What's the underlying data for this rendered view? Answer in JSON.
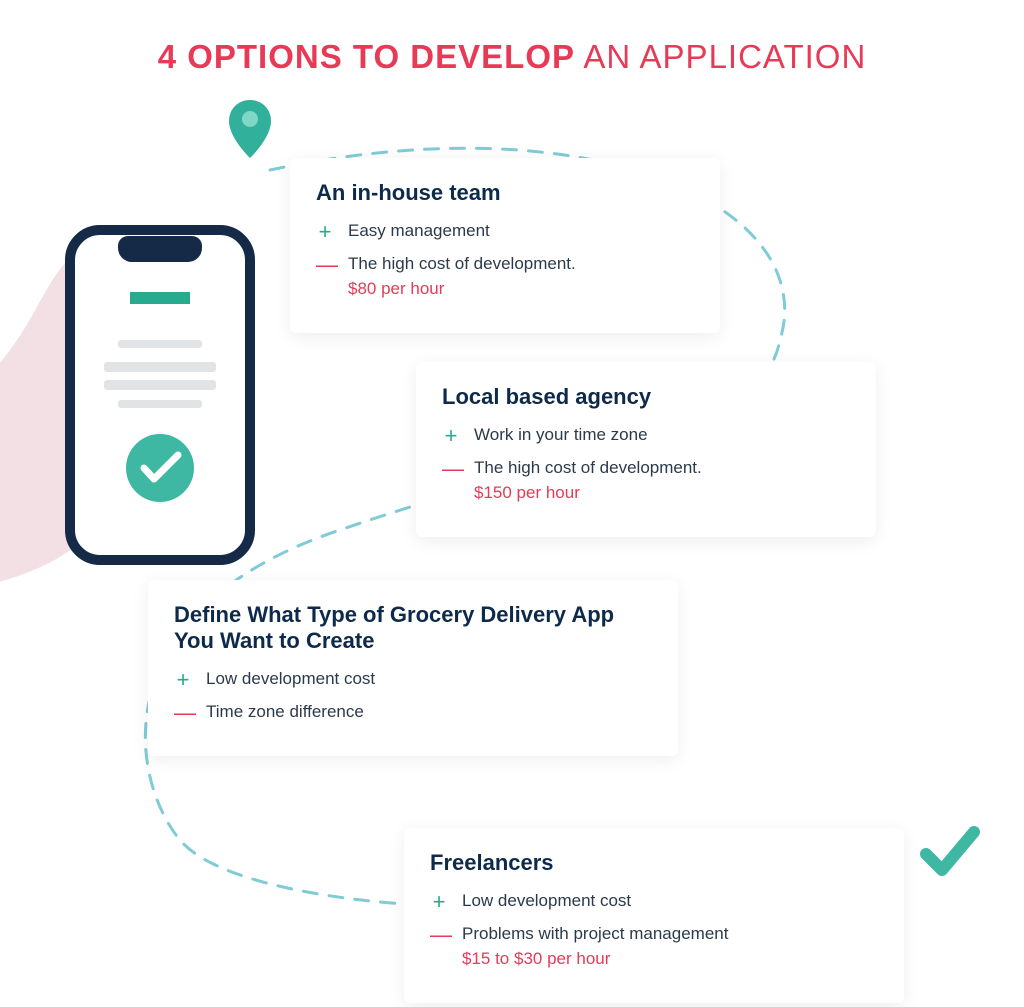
{
  "title": {
    "strong": "4 OPTIONS TO DEVELOP",
    "light": " AN APPLICATION"
  },
  "cards": {
    "inhouse": {
      "heading": "An in-house team",
      "pro": "Easy management",
      "con": "The high cost of development.",
      "price": "$80 per hour"
    },
    "local": {
      "heading": "Local based agency",
      "pro": "Work in your time zone",
      "con": "The high cost of development.",
      "price": "$150 per hour"
    },
    "define": {
      "heading": "Define What Type of Grocery Delivery App You Want to Create",
      "pro": "Low development cost",
      "con": "Time zone difference"
    },
    "freelancers": {
      "heading": "Freelancers",
      "pro": "Low development cost",
      "con": "Problems with project management",
      "price": "$15 to $30 per hour"
    }
  }
}
